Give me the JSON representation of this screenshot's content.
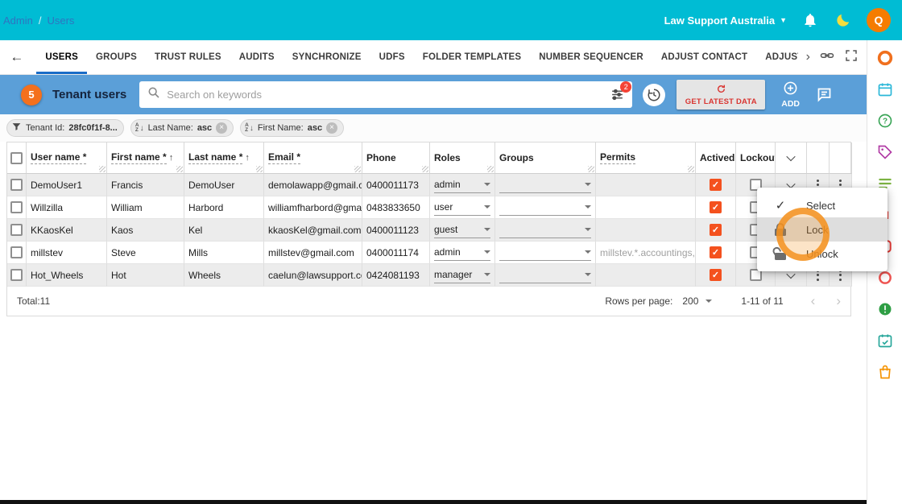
{
  "topbar": {
    "breadcrumb_left": "Admin",
    "breadcrumb_sep": "/",
    "breadcrumb_right": "Users",
    "org_name": "Law Support Australia",
    "avatar_initial": "Q"
  },
  "tabs": {
    "items": [
      "USERS",
      "GROUPS",
      "TRUST RULES",
      "AUDITS",
      "SYNCHRONIZE",
      "UDFS",
      "FOLDER TEMPLATES",
      "NUMBER SEQUENCER",
      "ADJUST CONTACT",
      "ADJUST EMPLOYEE"
    ],
    "active": "USERS"
  },
  "toolbar": {
    "step_badge": "5",
    "title": "Tenant users",
    "search_placeholder": "Search on keywords",
    "filter_badge": "2",
    "get_latest_label": "GET LATEST DATA",
    "add_label": "ADD"
  },
  "filters": {
    "chips": [
      {
        "label": "Tenant Id:",
        "value": "28fc0f1f-8..."
      },
      {
        "label": "Last Name:",
        "value": "asc"
      },
      {
        "label": "First Name:",
        "value": "asc"
      }
    ]
  },
  "table": {
    "columns": [
      "User name *",
      "First name *",
      "Last name *",
      "Email *",
      "Phone",
      "Roles",
      "Groups",
      "Permits",
      "Actived",
      "Lockout"
    ],
    "rows": [
      {
        "user_name": "DemoUser1",
        "first_name": "Francis",
        "last_name": "DemoUser",
        "email": "demolawapp@gmail.co",
        "phone": "0400011173",
        "role": "admin",
        "group": "",
        "permits": ""
      },
      {
        "user_name": "Willzilla",
        "first_name": "William",
        "last_name": "Harbord",
        "email": "williamfharbord@gmail",
        "phone": "0483833650",
        "role": "user",
        "group": "",
        "permits": ""
      },
      {
        "user_name": "KKaosKel",
        "first_name": "Kaos",
        "last_name": "Kel",
        "email": "kkaosKel@gmail.com",
        "phone": "0400011123",
        "role": "guest",
        "group": "",
        "permits": ""
      },
      {
        "user_name": "millstev",
        "first_name": "Steve",
        "last_name": "Mills",
        "email": "millstev@gmail.com",
        "phone": "0400011174",
        "role": "admin",
        "group": "",
        "permits": "millstev.*.accountings,r"
      },
      {
        "user_name": "Hot_Wheels",
        "first_name": "Hot",
        "last_name": "Wheels",
        "email": "caelun@lawsupport.cor",
        "phone": "0424081193",
        "role": "manager",
        "group": "",
        "permits": ""
      }
    ],
    "footer": {
      "total": "Total:11",
      "rows_per_page_label": "Rows per page:",
      "rows_per_page_value": "200",
      "range_label": "1-11 of 11"
    }
  },
  "context_menu": {
    "items": [
      {
        "label": "Select"
      },
      {
        "label": "Lock"
      },
      {
        "label": "Unlock"
      }
    ]
  },
  "colors": {
    "topbar_cyan": "#00BCD4",
    "toolbar_blue": "#5B9FD8",
    "accent_red": "#E53935",
    "checkbox_checked": "#F4511E",
    "badge_orange": "#F4701D"
  }
}
